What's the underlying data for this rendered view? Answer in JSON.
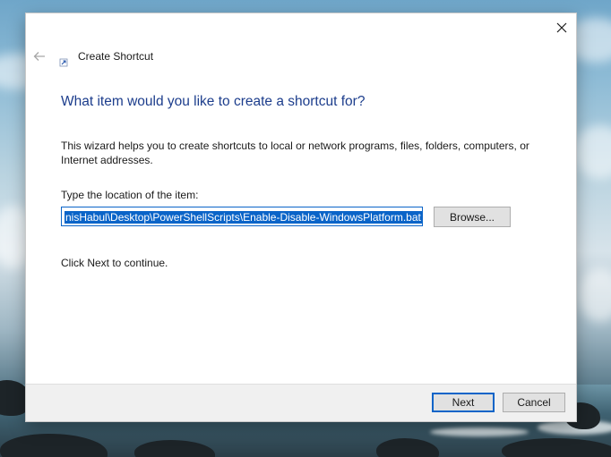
{
  "window": {
    "title": "Create Shortcut",
    "close_icon": "close-icon",
    "back_icon": "back-arrow-icon",
    "app_icon": "shortcut-icon"
  },
  "content": {
    "heading": "What item would you like to create a shortcut for?",
    "description": "This wizard helps you to create shortcuts to local or network programs, files, folders, computers, or Internet addresses.",
    "location_label": "Type the location of the item:",
    "location_value": "nisHabul\\Desktop\\PowerShellScripts\\Enable-Disable-WindowsPlatform.bat",
    "browse_label": "Browse...",
    "continue_text": "Click Next to continue."
  },
  "footer": {
    "next_label": "Next",
    "cancel_label": "Cancel"
  },
  "colors": {
    "heading": "#1c3d8c",
    "accent": "#0a64c8",
    "footer_bg": "#f0f0f0"
  }
}
